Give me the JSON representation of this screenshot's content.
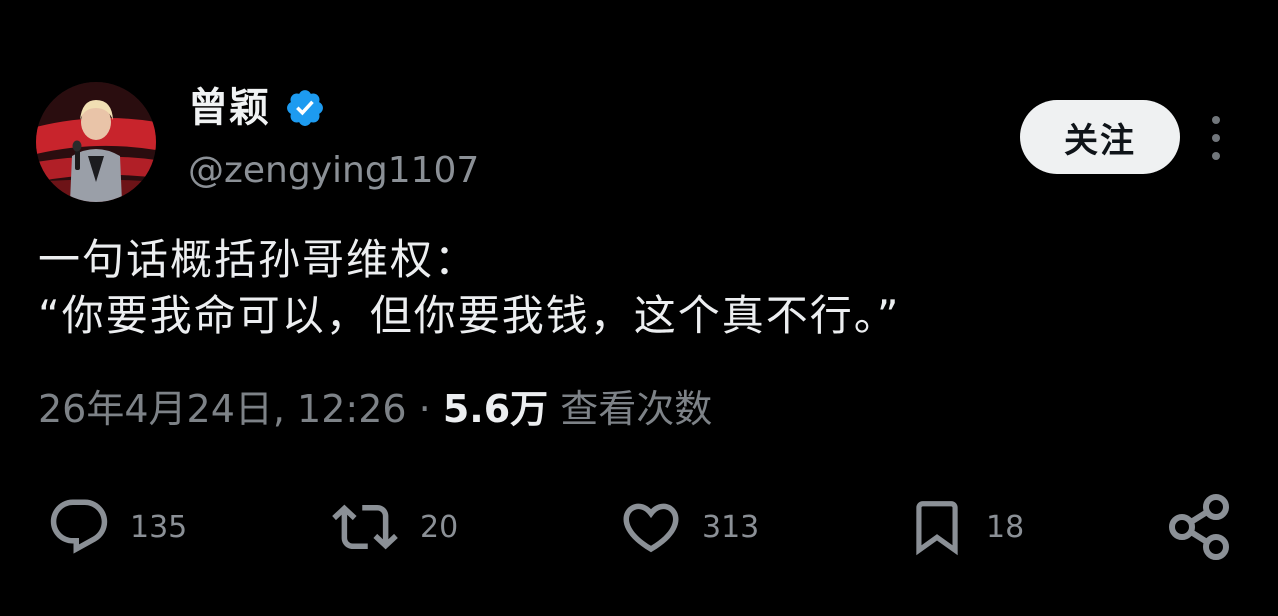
{
  "author": {
    "display_name": "曾颖",
    "handle": "@zengying1107",
    "verified_icon": "verified-badge-icon",
    "avatar_icon": "profile-photo"
  },
  "header": {
    "follow_label": "关注",
    "more_icon": "more-vertical-icon"
  },
  "tweet": {
    "lines": [
      "一句话概括孙哥维权：",
      "“你要我命可以，但你要我钱，这个真不行。”"
    ]
  },
  "meta": {
    "timestamp": "26年4月24日, 12:26",
    "separator": "·",
    "views_count": "5.6万",
    "views_label": "查看次数"
  },
  "actions": {
    "reply": {
      "icon": "reply-icon",
      "count": "135"
    },
    "retweet": {
      "icon": "retweet-icon",
      "count": "20"
    },
    "like": {
      "icon": "heart-icon",
      "count": "313"
    },
    "bookmark": {
      "icon": "bookmark-icon",
      "count": "18"
    },
    "share": {
      "icon": "share-icon"
    }
  },
  "colors": {
    "background": "#000000",
    "text_primary": "#e7e9ea",
    "text_secondary": "#8b9096",
    "verified_blue": "#1d9bf0",
    "follow_button_bg": "#eff1f2"
  }
}
